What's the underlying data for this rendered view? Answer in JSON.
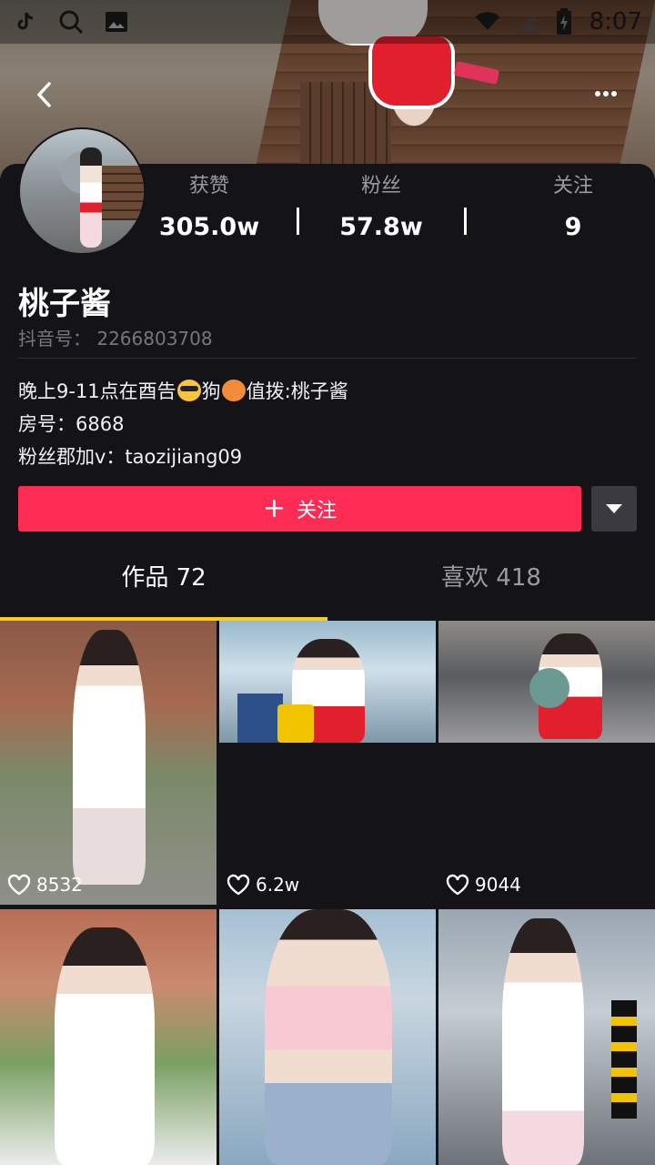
{
  "statusbar": {
    "time": "8:07",
    "icons": [
      "tiktok-icon",
      "search-icon",
      "image-icon",
      "wifi-icon",
      "signal-icon",
      "battery-icon"
    ]
  },
  "header": {
    "back_icon": "chevron-left-icon",
    "more_icon": "more-dots-icon"
  },
  "profile": {
    "stats": [
      {
        "label": "获赞",
        "value": "305.0w"
      },
      {
        "label": "粉丝",
        "value": "57.8w"
      },
      {
        "label": "关注",
        "value": "9"
      }
    ],
    "name": "桃子酱",
    "id_label": "抖音号：",
    "id_value": "2266803708",
    "bio": {
      "line1_a": "晚上9-11点在酉告",
      "line1_b": "狗",
      "line1_c": "值拨:桃子酱",
      "line2": "房号：6868",
      "line3": "粉丝郡加v：taozijiang09"
    }
  },
  "actions": {
    "follow_label": "关注",
    "follow_plus": "+"
  },
  "tabs": [
    {
      "label": "作品 72",
      "active": true
    },
    {
      "label": "喜欢 418",
      "active": false
    }
  ],
  "videos": [
    {
      "likes": "8532"
    },
    {
      "likes": "6.2w"
    },
    {
      "likes": "9044"
    },
    {
      "likes": ""
    },
    {
      "likes": ""
    },
    {
      "likes": ""
    }
  ],
  "colors": {
    "background": "#141418",
    "follow_button": "#fe2c55",
    "tab_indicator": "#face15",
    "secondary_text": "#9a9aa0"
  }
}
